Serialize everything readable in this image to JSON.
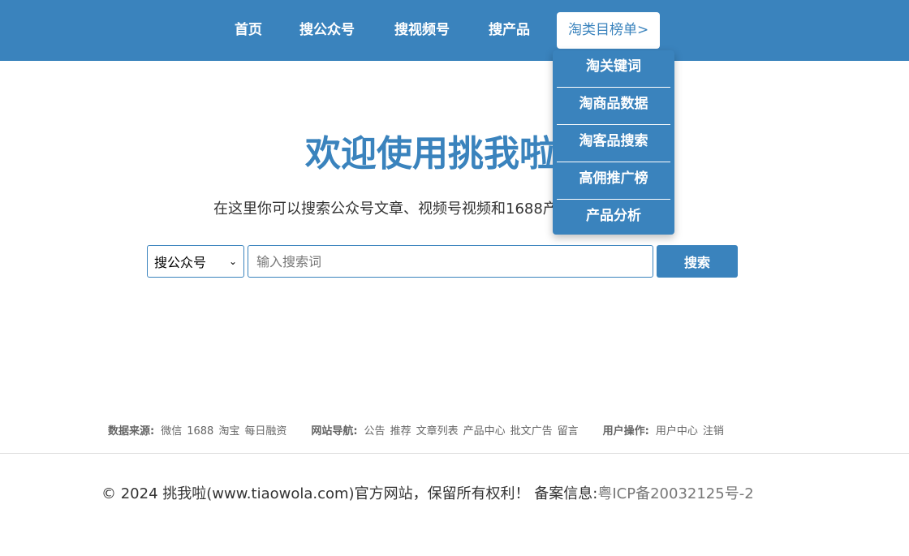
{
  "nav": {
    "items": [
      {
        "label": "首页"
      },
      {
        "label": "搜公众号"
      },
      {
        "label": "搜视频号"
      },
      {
        "label": "搜产品"
      },
      {
        "label": "淘类目榜单>"
      }
    ],
    "dropdown": [
      {
        "label": "淘关键词"
      },
      {
        "label": "淘商品数据"
      },
      {
        "label": "淘客品搜索"
      },
      {
        "label": "高佣推广榜"
      },
      {
        "label": "产品分析"
      }
    ]
  },
  "hero": {
    "title": "欢迎使用挑我啦",
    "subtitle": "在这里你可以搜索公众号文章、视频号视频和1688产品"
  },
  "search": {
    "select_value": "搜公众号",
    "placeholder": "输入搜索词",
    "button_label": "搜索"
  },
  "footer_links": {
    "data_source": {
      "label": "数据来源:",
      "items": [
        "微信",
        "1688",
        "淘宝",
        "每日融资"
      ]
    },
    "site_nav": {
      "label": "网站导航:",
      "items": [
        "公告",
        "推荐",
        "文章列表",
        "产品中心",
        "批文广告",
        "留言"
      ]
    },
    "user_ops": {
      "label": "用户操作:",
      "items": [
        "用户中心",
        "注销"
      ]
    }
  },
  "copyright": {
    "text": "© 2024 挑我啦(www.tiaowola.com)官方网站，保留所有权利！  备案信息:",
    "icp": "粤ICP备20032125号-2"
  },
  "colors": {
    "brand": "#3a83bd"
  }
}
